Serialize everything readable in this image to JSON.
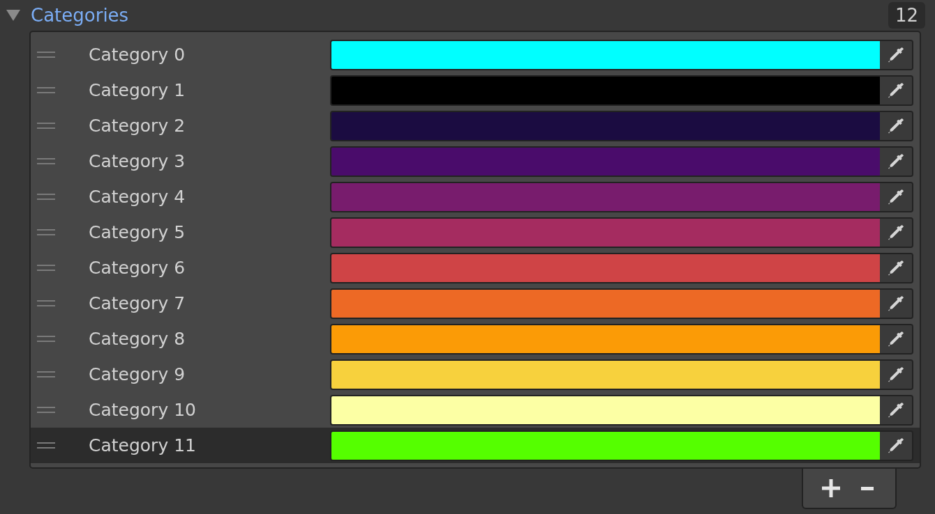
{
  "section": {
    "title": "Categories",
    "expanded": true,
    "count": "12"
  },
  "categories": [
    {
      "label": "Category 0",
      "color": "#00ffff",
      "selected": false
    },
    {
      "label": "Category 1",
      "color": "#000000",
      "selected": false
    },
    {
      "label": "Category 2",
      "color": "#1b0c41",
      "selected": false
    },
    {
      "label": "Category 3",
      "color": "#4a0c6b",
      "selected": false
    },
    {
      "label": "Category 4",
      "color": "#781c6d",
      "selected": false
    },
    {
      "label": "Category 5",
      "color": "#a52c60",
      "selected": false
    },
    {
      "label": "Category 6",
      "color": "#cf4446",
      "selected": false
    },
    {
      "label": "Category 7",
      "color": "#ed6925",
      "selected": false
    },
    {
      "label": "Category 8",
      "color": "#fb9b06",
      "selected": false
    },
    {
      "label": "Category 9",
      "color": "#f7d13d",
      "selected": false
    },
    {
      "label": "Category 10",
      "color": "#fcffa4",
      "selected": false
    },
    {
      "label": "Category 11",
      "color": "#55ff00",
      "selected": true
    }
  ]
}
